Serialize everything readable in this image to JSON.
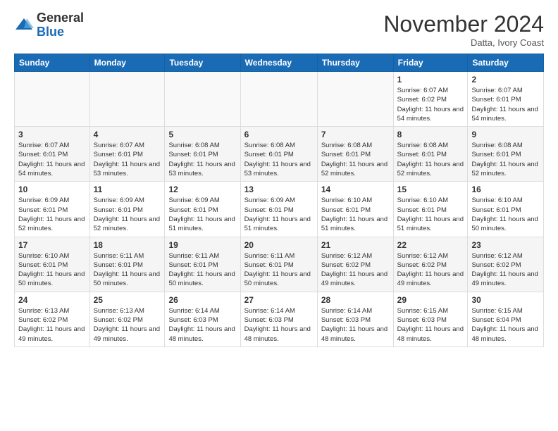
{
  "header": {
    "logo_line1": "General",
    "logo_line2": "Blue",
    "month_title": "November 2024",
    "location": "Datta, Ivory Coast"
  },
  "weekdays": [
    "Sunday",
    "Monday",
    "Tuesday",
    "Wednesday",
    "Thursday",
    "Friday",
    "Saturday"
  ],
  "weeks": [
    [
      {
        "day": "",
        "info": ""
      },
      {
        "day": "",
        "info": ""
      },
      {
        "day": "",
        "info": ""
      },
      {
        "day": "",
        "info": ""
      },
      {
        "day": "",
        "info": ""
      },
      {
        "day": "1",
        "info": "Sunrise: 6:07 AM\nSunset: 6:02 PM\nDaylight: 11 hours\nand 54 minutes."
      },
      {
        "day": "2",
        "info": "Sunrise: 6:07 AM\nSunset: 6:01 PM\nDaylight: 11 hours\nand 54 minutes."
      }
    ],
    [
      {
        "day": "3",
        "info": "Sunrise: 6:07 AM\nSunset: 6:01 PM\nDaylight: 11 hours\nand 54 minutes."
      },
      {
        "day": "4",
        "info": "Sunrise: 6:07 AM\nSunset: 6:01 PM\nDaylight: 11 hours\nand 53 minutes."
      },
      {
        "day": "5",
        "info": "Sunrise: 6:08 AM\nSunset: 6:01 PM\nDaylight: 11 hours\nand 53 minutes."
      },
      {
        "day": "6",
        "info": "Sunrise: 6:08 AM\nSunset: 6:01 PM\nDaylight: 11 hours\nand 53 minutes."
      },
      {
        "day": "7",
        "info": "Sunrise: 6:08 AM\nSunset: 6:01 PM\nDaylight: 11 hours\nand 52 minutes."
      },
      {
        "day": "8",
        "info": "Sunrise: 6:08 AM\nSunset: 6:01 PM\nDaylight: 11 hours\nand 52 minutes."
      },
      {
        "day": "9",
        "info": "Sunrise: 6:08 AM\nSunset: 6:01 PM\nDaylight: 11 hours\nand 52 minutes."
      }
    ],
    [
      {
        "day": "10",
        "info": "Sunrise: 6:09 AM\nSunset: 6:01 PM\nDaylight: 11 hours\nand 52 minutes."
      },
      {
        "day": "11",
        "info": "Sunrise: 6:09 AM\nSunset: 6:01 PM\nDaylight: 11 hours\nand 52 minutes."
      },
      {
        "day": "12",
        "info": "Sunrise: 6:09 AM\nSunset: 6:01 PM\nDaylight: 11 hours\nand 51 minutes."
      },
      {
        "day": "13",
        "info": "Sunrise: 6:09 AM\nSunset: 6:01 PM\nDaylight: 11 hours\nand 51 minutes."
      },
      {
        "day": "14",
        "info": "Sunrise: 6:10 AM\nSunset: 6:01 PM\nDaylight: 11 hours\nand 51 minutes."
      },
      {
        "day": "15",
        "info": "Sunrise: 6:10 AM\nSunset: 6:01 PM\nDaylight: 11 hours\nand 51 minutes."
      },
      {
        "day": "16",
        "info": "Sunrise: 6:10 AM\nSunset: 6:01 PM\nDaylight: 11 hours\nand 50 minutes."
      }
    ],
    [
      {
        "day": "17",
        "info": "Sunrise: 6:10 AM\nSunset: 6:01 PM\nDaylight: 11 hours\nand 50 minutes."
      },
      {
        "day": "18",
        "info": "Sunrise: 6:11 AM\nSunset: 6:01 PM\nDaylight: 11 hours\nand 50 minutes."
      },
      {
        "day": "19",
        "info": "Sunrise: 6:11 AM\nSunset: 6:01 PM\nDaylight: 11 hours\nand 50 minutes."
      },
      {
        "day": "20",
        "info": "Sunrise: 6:11 AM\nSunset: 6:01 PM\nDaylight: 11 hours\nand 50 minutes."
      },
      {
        "day": "21",
        "info": "Sunrise: 6:12 AM\nSunset: 6:02 PM\nDaylight: 11 hours\nand 49 minutes."
      },
      {
        "day": "22",
        "info": "Sunrise: 6:12 AM\nSunset: 6:02 PM\nDaylight: 11 hours\nand 49 minutes."
      },
      {
        "day": "23",
        "info": "Sunrise: 6:12 AM\nSunset: 6:02 PM\nDaylight: 11 hours\nand 49 minutes."
      }
    ],
    [
      {
        "day": "24",
        "info": "Sunrise: 6:13 AM\nSunset: 6:02 PM\nDaylight: 11 hours\nand 49 minutes."
      },
      {
        "day": "25",
        "info": "Sunrise: 6:13 AM\nSunset: 6:02 PM\nDaylight: 11 hours\nand 49 minutes."
      },
      {
        "day": "26",
        "info": "Sunrise: 6:14 AM\nSunset: 6:03 PM\nDaylight: 11 hours\nand 48 minutes."
      },
      {
        "day": "27",
        "info": "Sunrise: 6:14 AM\nSunset: 6:03 PM\nDaylight: 11 hours\nand 48 minutes."
      },
      {
        "day": "28",
        "info": "Sunrise: 6:14 AM\nSunset: 6:03 PM\nDaylight: 11 hours\nand 48 minutes."
      },
      {
        "day": "29",
        "info": "Sunrise: 6:15 AM\nSunset: 6:03 PM\nDaylight: 11 hours\nand 48 minutes."
      },
      {
        "day": "30",
        "info": "Sunrise: 6:15 AM\nSunset: 6:04 PM\nDaylight: 11 hours\nand 48 minutes."
      }
    ]
  ]
}
